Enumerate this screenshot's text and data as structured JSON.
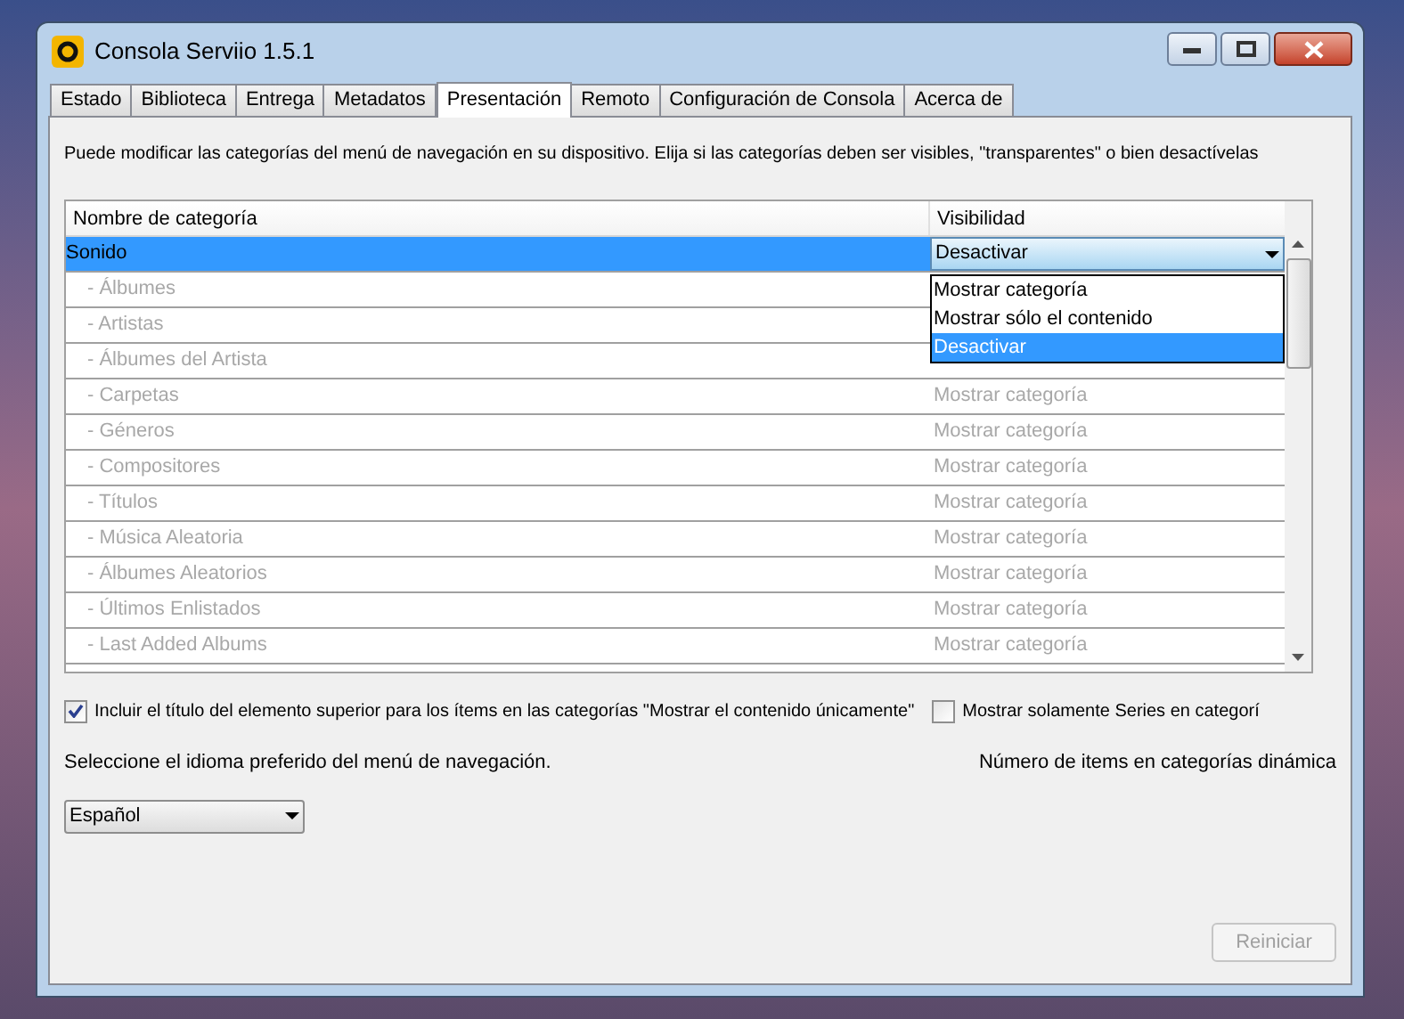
{
  "window": {
    "title": "Consola Serviio 1.5.1"
  },
  "tabs": [
    {
      "label": "Estado",
      "selected": false
    },
    {
      "label": "Biblioteca",
      "selected": false
    },
    {
      "label": "Entrega",
      "selected": false
    },
    {
      "label": "Metadatos",
      "selected": false
    },
    {
      "label": "Presentación",
      "selected": true
    },
    {
      "label": "Remoto",
      "selected": false
    },
    {
      "label": "Configuración de Consola",
      "selected": false
    },
    {
      "label": "Acerca de",
      "selected": false
    }
  ],
  "description": "Puede modificar las categorías del menú de navegación en su dispositivo. Elija si las categorías deben ser visibles, \"transparentes\" o bien desactívelas",
  "table": {
    "columns": [
      "Nombre de categoría",
      "Visibilidad"
    ],
    "rows": [
      {
        "name": "Sonido",
        "visibility": "Desactivar",
        "selected": true,
        "children": [
          {
            "name": "- Álbumes",
            "disabled": true
          },
          {
            "name": "- Artistas",
            "disabled": true
          },
          {
            "name": "- Álbumes del Artista",
            "disabled": true
          },
          {
            "name": "- Carpetas",
            "visibility": "Mostrar categoría",
            "disabled": true
          },
          {
            "name": "- Géneros",
            "visibility": "Mostrar categoría",
            "disabled": true
          },
          {
            "name": "- Compositores",
            "visibility": "Mostrar categoría",
            "disabled": true
          },
          {
            "name": "- Títulos",
            "visibility": "Mostrar categoría",
            "disabled": true
          },
          {
            "name": "- Música Aleatoria",
            "visibility": "Mostrar categoría",
            "disabled": true
          },
          {
            "name": "- Álbumes Aleatorios",
            "visibility": "Mostrar categoría",
            "disabled": true
          },
          {
            "name": "- Últimos Enlistados",
            "visibility": "Mostrar categoría",
            "disabled": true
          },
          {
            "name": "- Last Added Albums",
            "visibility": "Mostrar categoría",
            "disabled": true
          }
        ]
      }
    ],
    "dropdown_options": [
      {
        "label": "Mostrar categoría",
        "selected": false
      },
      {
        "label": "Mostrar sólo el contenido",
        "selected": false
      },
      {
        "label": "Desactivar",
        "selected": true
      }
    ]
  },
  "checkboxes": [
    {
      "label": "Incluir el título del elemento superior para los ítems en las categorías \"Mostrar el contenido únicamente\"",
      "checked": true
    },
    {
      "label": "Mostrar solamente Series en categorí",
      "checked": false
    }
  ],
  "language_label": "Seleccione el idioma preferido del menú de navegación.",
  "dynamic_items_label": "Número de items en categorías dinámica",
  "language": {
    "value": "Español"
  },
  "reset_button": {
    "label": "Reiniciar",
    "disabled": true
  }
}
